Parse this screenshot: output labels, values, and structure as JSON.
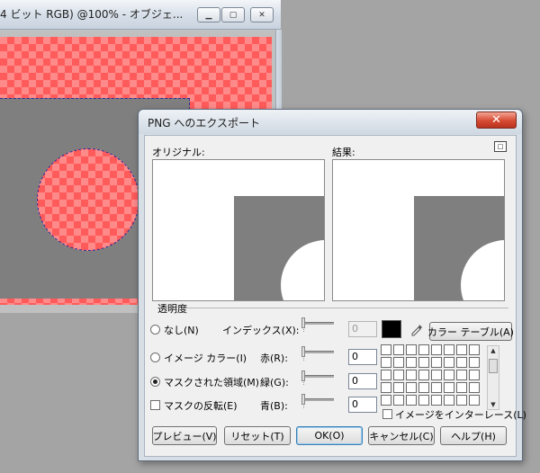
{
  "bg_window": {
    "title": "4 ビット RGB) @100% - オブジェ..."
  },
  "dialog": {
    "title": "PNG へのエクスポート",
    "original_label": "オリジナル:",
    "result_label": "結果:",
    "transparency_label": "透明度",
    "options": {
      "none": "なし(N)",
      "image_color": "イメージ カラー(I)",
      "masked_area": "マスクされた領域(M)",
      "invert_mask": "マスクの反転(E)",
      "interlace": "イメージをインターレース(L)"
    },
    "selected_option": "masked_area",
    "fields": {
      "index_label": "インデックス(X):",
      "index_value": "0",
      "red_label": "赤(R):",
      "red_value": "0",
      "green_label": "緑(G):",
      "green_value": "0",
      "blue_label": "青(B):",
      "blue_value": "0"
    },
    "color_table_button": "カラー テーブル(A)",
    "buttons": {
      "preview": "プレビュー(V)",
      "reset": "リセット(T)",
      "ok": "OK(O)",
      "cancel": "キャンセル(C)",
      "help": "ヘルプ(H)"
    },
    "swatch_color": "#000000"
  }
}
